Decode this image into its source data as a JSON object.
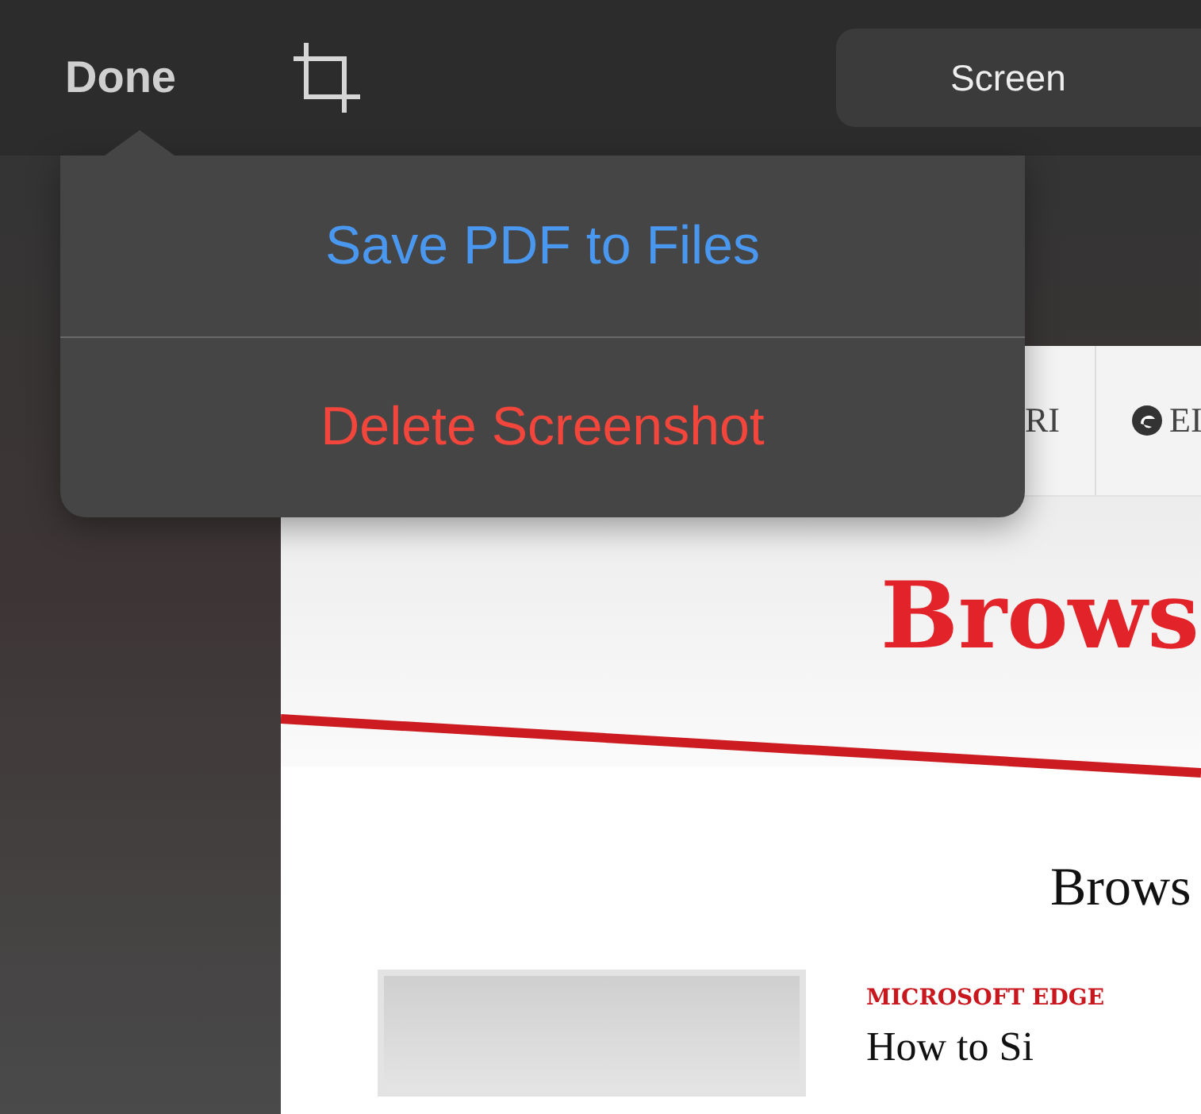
{
  "toolbar": {
    "done_label": "Done",
    "segment_label": "Screen"
  },
  "menu": {
    "items": [
      {
        "label": "Save PDF to Files",
        "kind": "default"
      },
      {
        "label": "Delete Screenshot",
        "kind": "destructive"
      }
    ]
  },
  "document": {
    "tabs": [
      {
        "label": "RI",
        "kind": "text"
      },
      {
        "label": "EI",
        "kind": "icon"
      }
    ],
    "title": "Brows",
    "subtitle": "Brows",
    "article": {
      "category": "MICROSOFT EDGE",
      "headline": "How to Si"
    }
  }
}
